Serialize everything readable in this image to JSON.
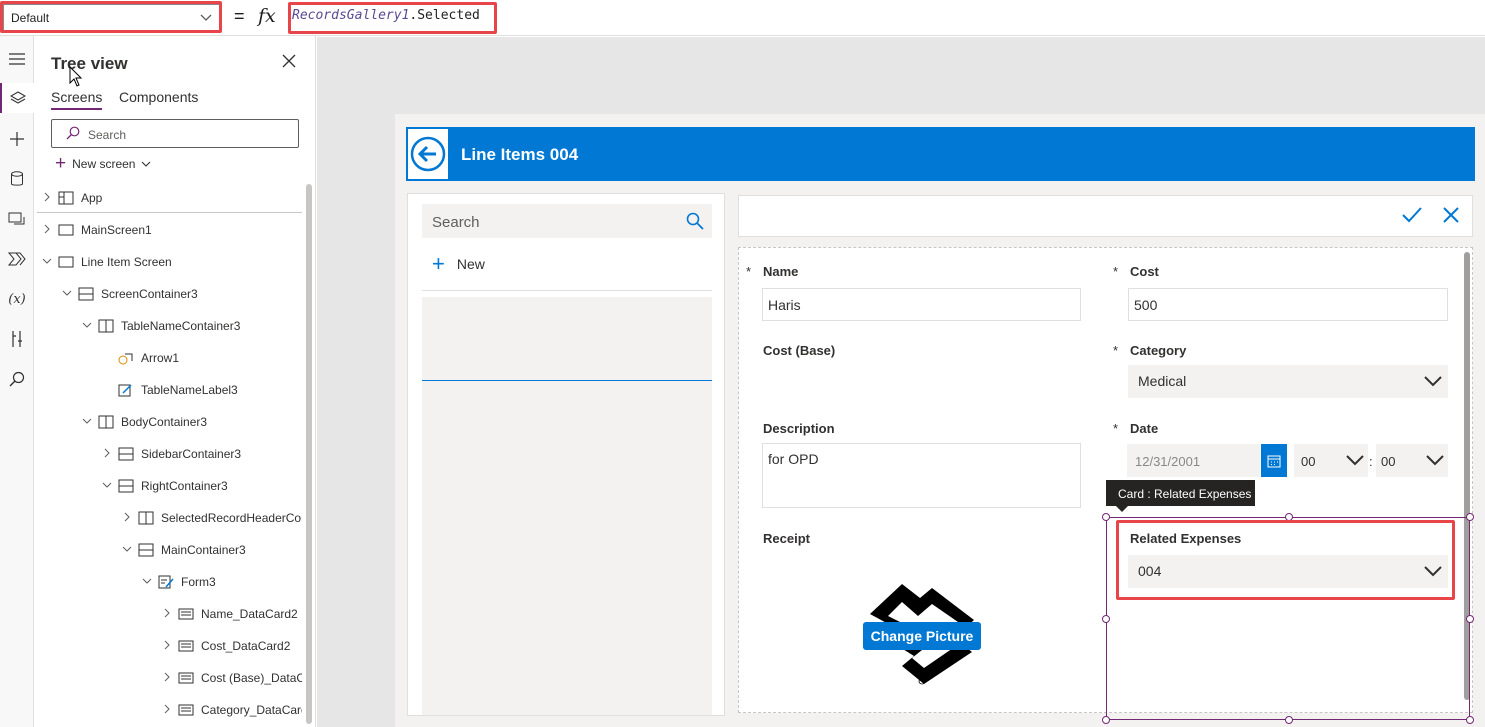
{
  "formula_bar": {
    "property": "Default",
    "equals": "=",
    "fx": "fx",
    "formula_fn": "RecordsGallery1",
    "formula_rest": ".Selected"
  },
  "tree_view": {
    "title": "Tree view",
    "tabs": {
      "screens": "Screens",
      "components": "Components"
    },
    "search_placeholder": "Search",
    "new_screen": "New screen",
    "items": [
      {
        "label": "App"
      },
      {
        "label": "MainScreen1"
      },
      {
        "label": "Line Item Screen"
      },
      {
        "label": "ScreenContainer3"
      },
      {
        "label": "TableNameContainer3"
      },
      {
        "label": "Arrow1"
      },
      {
        "label": "TableNameLabel3"
      },
      {
        "label": "BodyContainer3"
      },
      {
        "label": "SidebarContainer3"
      },
      {
        "label": "RightContainer3"
      },
      {
        "label": "SelectedRecordHeaderCon"
      },
      {
        "label": "MainContainer3"
      },
      {
        "label": "Form3"
      },
      {
        "label": "Name_DataCard2"
      },
      {
        "label": "Cost_DataCard2"
      },
      {
        "label": "Cost (Base)_DataCa"
      },
      {
        "label": "Category_DataCard"
      }
    ]
  },
  "app": {
    "header_title": "Line Items 004",
    "sidebar": {
      "search_placeholder": "Search",
      "new_label": "New"
    },
    "form": {
      "name_label": "Name",
      "name_value": "Haris",
      "cost_label": "Cost",
      "cost_value": "500",
      "cost_base_label": "Cost (Base)",
      "category_label": "Category",
      "category_value": "Medical",
      "description_label": "Description",
      "description_value": "for OPD",
      "date_label": "Date",
      "date_value": "12/31/2001",
      "hour_value": "00",
      "time_sep": ":",
      "minute_value": "00",
      "receipt_label": "Receipt",
      "change_picture": "Change Picture",
      "related_label": "Related Expenses",
      "related_value": "004",
      "required_mark": "*"
    },
    "tooltip": "Card : Related Expenses"
  },
  "colors": {
    "accent_blue": "#0078d4",
    "highlight_red": "#e8454a",
    "selection_purple": "#742774"
  }
}
